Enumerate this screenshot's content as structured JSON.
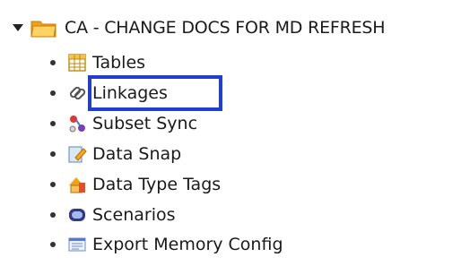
{
  "tree": {
    "root": {
      "label": "CA - CHANGE DOCS FOR MD REFRESH",
      "icon": "folder-icon",
      "expanded": true
    },
    "items": [
      {
        "label": "Tables",
        "icon": "table-icon"
      },
      {
        "label": "Linkages",
        "icon": "link-icon",
        "highlighted": true
      },
      {
        "label": "Subset Sync",
        "icon": "subset-sync-icon"
      },
      {
        "label": "Data Snap",
        "icon": "data-snap-icon"
      },
      {
        "label": "Data Type Tags",
        "icon": "data-type-tags-icon"
      },
      {
        "label": "Scenarios",
        "icon": "scenarios-icon"
      },
      {
        "label": "Export Memory Config",
        "icon": "export-memory-config-icon"
      }
    ]
  },
  "colors": {
    "highlight": "#1e3fd0",
    "folder": "#f2a01e"
  }
}
